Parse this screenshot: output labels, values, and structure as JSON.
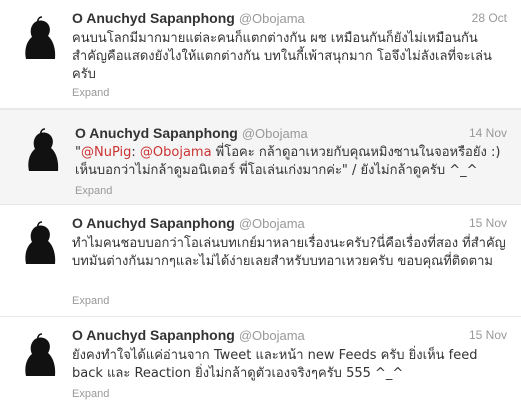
{
  "tweets": [
    {
      "name": "O Anuchyd Sapanphong",
      "handle": "@Obojama",
      "time": "28 Oct",
      "text": "คนบนโลกมีมากมายแต่ละคนก็แตกต่างกัน ผช เหมือนกันก็ยังไม่เหมือนกัน สำคัญคือแสดงยังไงให้แตกต่างกัน บทในกี้เพ้าสนุกมาก โอจึงไม่ลังเลที่จะเล่นครับ",
      "expand": "Expand"
    },
    {
      "name": "O Anuchyd Sapanphong",
      "handle": "@Obojama",
      "time": "14 Nov",
      "mention1": "@NuPig",
      "sep": ": ",
      "mention2": "@Obojama",
      "text": " พี่โอคะ กล้าดูอาเหวยกับคุณหมิงซานในจอหรือยัง :) เห็นบอกว่าไม่กล้าดูมอนิเตอร์ พี่โอเล่นเก่งมากค่ะ\" / ยังไม่กล้าดูครับ ^_^",
      "quote_open": "\"",
      "expand": "Expand"
    },
    {
      "name": "O Anuchyd Sapanphong",
      "handle": "@Obojama",
      "time": "15 Nov",
      "text": "ทำไมคนชอบบอกว่าโอเล่นบทเกย์มาหลายเรื่องนะครับ?นี่คือเรื่องที่สอง ที่สำคัญบทมันต่างกันมากๆและไม่ได้ง่ายเลยสำหรับบทอาเหวยครับ ขอบคุณที่ติดตาม",
      "expand": "Expand"
    },
    {
      "name": "O Anuchyd Sapanphong",
      "handle": "@Obojama",
      "time": "15 Nov",
      "text": "ยังคงทำใจได้แค่อ่านจาก Tweet และหน้า new Feeds ครับ ยิ่งเห็น feed back และ Reaction ยิ่งไม่กล้าดูตัวเองจริงๆครับ 555 ^_^",
      "expand": "Expand"
    }
  ]
}
